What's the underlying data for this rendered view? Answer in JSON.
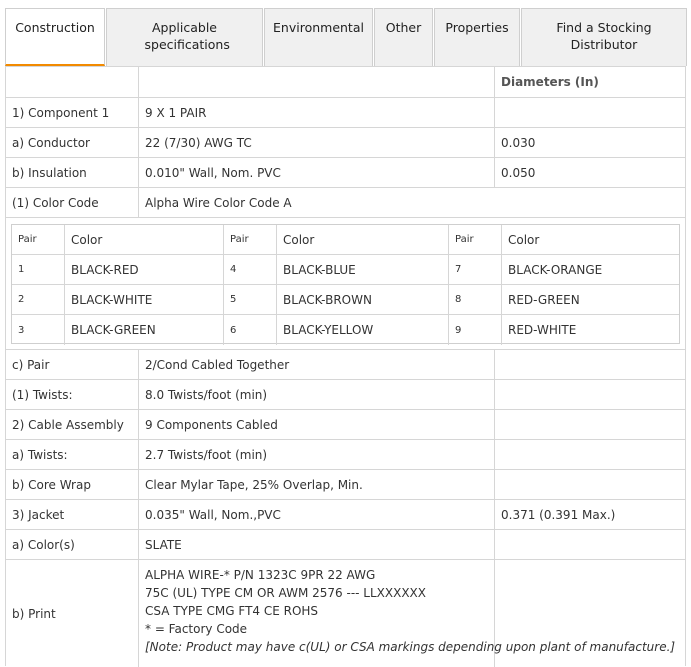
{
  "tabs": [
    {
      "label": "Construction"
    },
    {
      "label": "Applicable specifications"
    },
    {
      "label": "Environmental"
    },
    {
      "label": "Other"
    },
    {
      "label": "Properties"
    },
    {
      "label": "Find a Stocking Distributor"
    }
  ],
  "table": {
    "diameters_header": "Diameters (In)",
    "rows": [
      {
        "label": "1) Component 1",
        "value": "9 X 1 PAIR",
        "diameter": ""
      },
      {
        "label": "a) Conductor",
        "value": "22 (7/30) AWG TC",
        "diameter": "0.030"
      },
      {
        "label": "b) Insulation",
        "value": "0.010\" Wall, Nom. PVC",
        "diameter": "0.050"
      },
      {
        "label": "(1) Color Code",
        "value": "Alpha Wire Color Code A",
        "diameter": ""
      }
    ],
    "rows2": [
      {
        "label": "c) Pair",
        "value": "2/Cond Cabled Together",
        "diameter": ""
      },
      {
        "label": "(1) Twists:",
        "value": "8.0 Twists/foot (min)",
        "diameter": ""
      },
      {
        "label": "2) Cable Assembly",
        "value": "9 Components Cabled",
        "diameter": ""
      },
      {
        "label": "a) Twists:",
        "value": "2.7 Twists/foot (min)",
        "diameter": ""
      },
      {
        "label": "b) Core Wrap",
        "value": "Clear Mylar Tape, 25% Overlap, Min.",
        "diameter": ""
      },
      {
        "label": "3) Jacket",
        "value": "0.035\" Wall, Nom.,PVC",
        "diameter": "0.371 (0.391 Max.)"
      },
      {
        "label": "a) Color(s)",
        "value": "SLATE",
        "diameter": ""
      }
    ],
    "print_row": {
      "label": "b) Print",
      "lines": [
        "ALPHA WIRE-* P/N 1323C 9PR 22 AWG",
        "75C (UL) TYPE CM OR AWM 2576 --- LLXXXXXX",
        "CSA TYPE CMG FT4 CE ROHS",
        "* = Factory Code"
      ],
      "note": "[Note: Product may have c(UL) or CSA markings depending upon plant of manufacture.]"
    }
  },
  "color_code": {
    "headers": {
      "pair": "Pair",
      "color": "Color"
    },
    "rows": [
      [
        {
          "pair": "1",
          "color": "BLACK-RED"
        },
        {
          "pair": "4",
          "color": "BLACK-BLUE"
        },
        {
          "pair": "7",
          "color": "BLACK-ORANGE"
        }
      ],
      [
        {
          "pair": "2",
          "color": "BLACK-WHITE"
        },
        {
          "pair": "5",
          "color": "BLACK-BROWN"
        },
        {
          "pair": "8",
          "color": "RED-GREEN"
        }
      ],
      [
        {
          "pair": "3",
          "color": "BLACK-GREEN"
        },
        {
          "pair": "6",
          "color": "BLACK-YELLOW"
        },
        {
          "pair": "9",
          "color": "RED-WHITE"
        }
      ]
    ]
  },
  "colors": {
    "accent": "#f28a00",
    "border": "#d6d6d6",
    "tab_bg": "#f0f0f0"
  }
}
